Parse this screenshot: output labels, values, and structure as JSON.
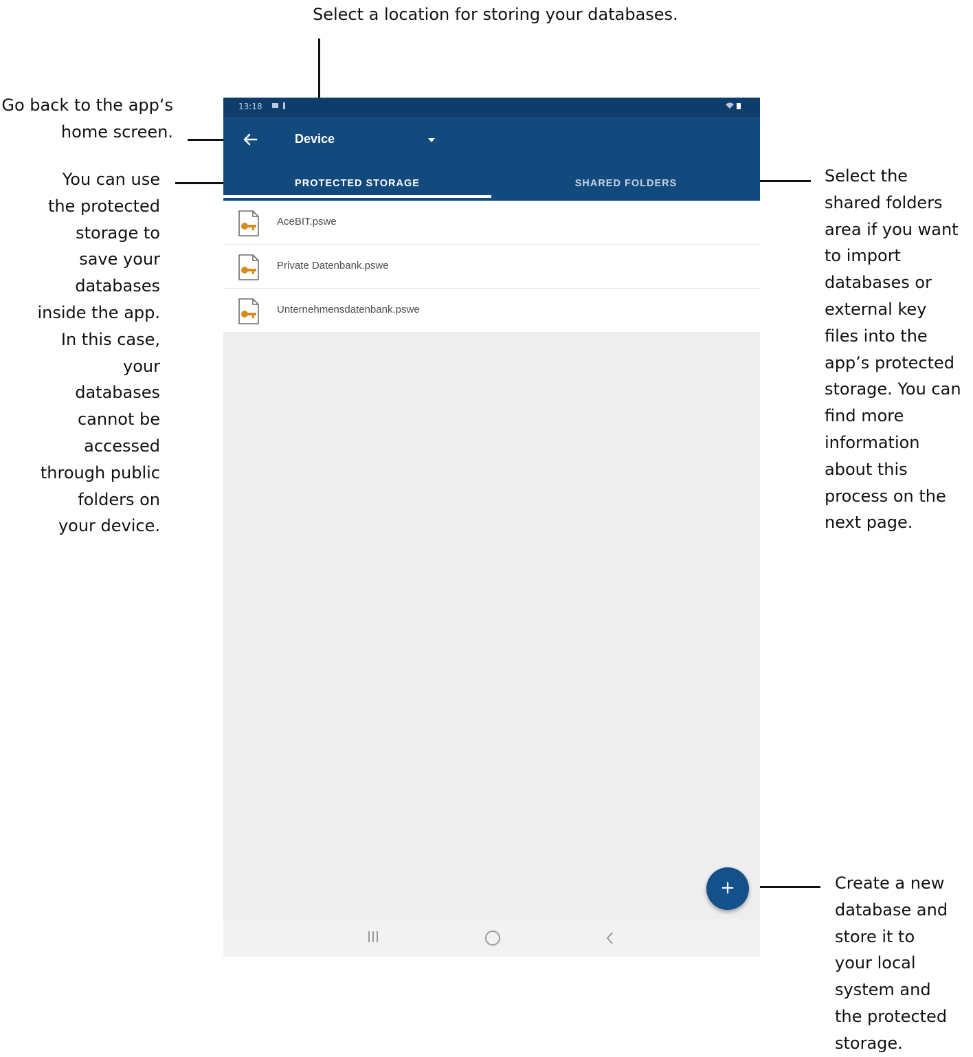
{
  "callouts": {
    "top": "Select a location for storing your databases.",
    "back": "Go back to the app‘s\nhome screen.",
    "protected": "You can use\nthe protected\nstorage to\nsave your\ndatabases\ninside the app.\nIn this case,\nyour\ndatabases\ncannot be\naccessed\nthrough public\nfolders on\nyour device.",
    "shared": "Select the\nshared folders\narea if you want\nto import\ndatabases or\nexternal key\nfiles into the\napp’s protected\nstorage. You can\nfind more\ninformation\nabout this\nprocess on the\nnext page.",
    "fab": "Create a new\ndatabase and\nstore it to\nyour local\nsystem and\nthe protected\nstorage."
  },
  "status_bar": {
    "time": "13:18"
  },
  "app_bar": {
    "title": "Device",
    "tabs": [
      {
        "label": "PROTECTED STORAGE",
        "active": true
      },
      {
        "label": "SHARED FOLDERS",
        "active": false
      }
    ]
  },
  "files": [
    {
      "name": "AceBIT.pswe",
      "icon": "database-file-icon"
    },
    {
      "name": "Private Datenbank.pswe",
      "icon": "database-file-icon"
    },
    {
      "name": "Unternehmensdatenbank.pswe",
      "icon": "database-file-icon"
    }
  ],
  "fab": {
    "icon": "plus-icon",
    "label": "+"
  },
  "colors": {
    "primary": "#124a7e",
    "status_bar": "#0f3d6b",
    "fab": "#145089",
    "file_icon_accent": "#d88a1d"
  }
}
